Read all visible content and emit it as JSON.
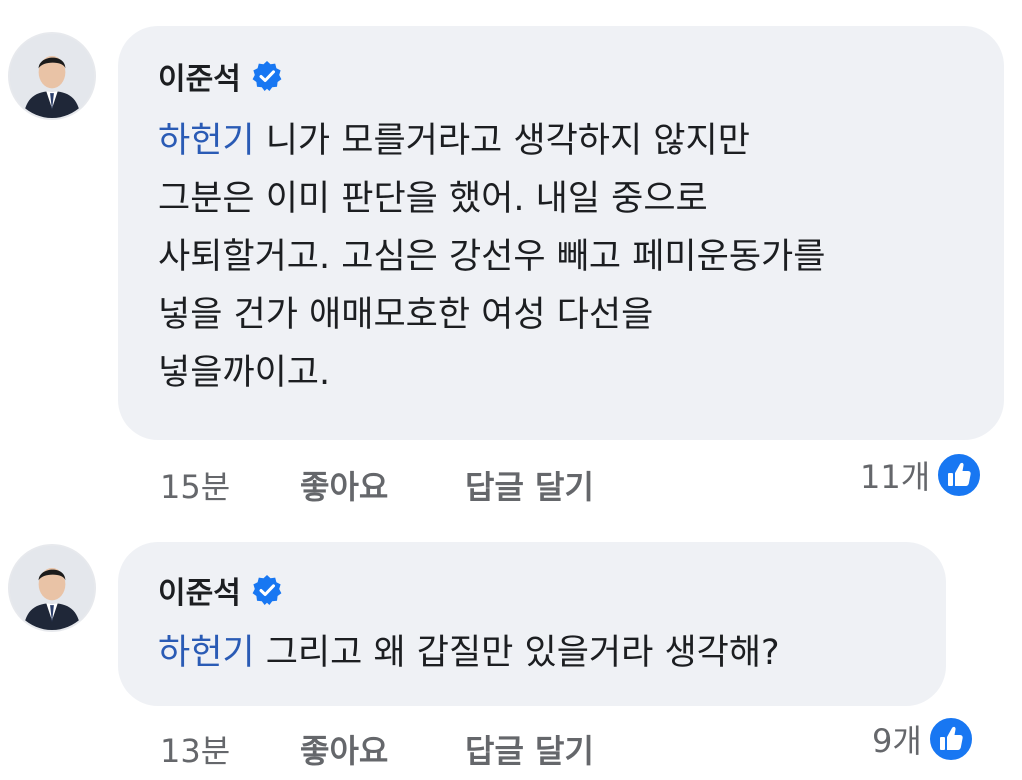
{
  "comments": [
    {
      "author": "이준석",
      "mention": "하헌기",
      "text": " 니가 모를거라고 생각하지 않지만\n그분은 이미 판단을 했어. 내일 중으로\n사퇴할거고. 고심은 강선우 빼고 페미운동가를\n넣을 건가 애매모호한 여성 다선을\n넣을까이고.",
      "time": "15분",
      "like_label": "좋아요",
      "reply_label": "답글 달기",
      "reaction_count": "11개"
    },
    {
      "author": "이준석",
      "mention": "하헌기",
      "text": " 그리고 왜 갑질만 있을거라 생각해?",
      "time": "13분",
      "like_label": "좋아요",
      "reply_label": "답글 달기",
      "reaction_count": "9개"
    }
  ],
  "colors": {
    "mention": "#2a5bb5",
    "bubble": "#eff1f5",
    "meta": "#65676b",
    "verified_badge": "#1877f2",
    "like_badge": "#1877f2"
  },
  "icons": {
    "verified": "verified-badge-icon",
    "like": "thumbs-up-icon",
    "avatar": "profile-photo"
  }
}
